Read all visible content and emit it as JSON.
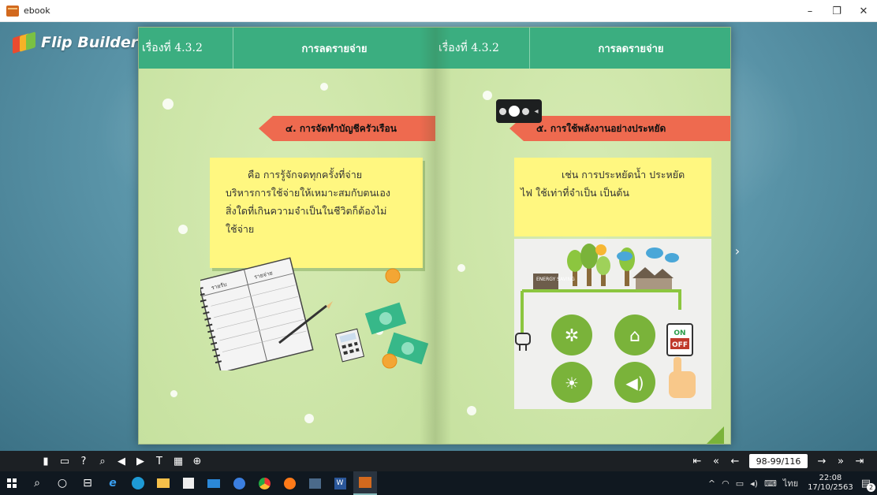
{
  "window": {
    "title": "ebook",
    "controls": [
      "–",
      "❐",
      "✕"
    ]
  },
  "logo": {
    "text": "Flip Builder"
  },
  "left_page": {
    "header_no": "เรื่องที่ 4.3.2",
    "header_topic": "การลดรายจ่าย",
    "ribbon": "๔. การจัดทำบัญชีครัวเรือน",
    "note_lines": [
      "คือ การรู้จักจดทุกครั้งที่จ่าย",
      "บริหารการใช้จ่ายให้เหมาะสมกับตนเอง",
      "สิ่งใดที่เกินความจำเป็นในชีวิตก็ต้องไม่",
      "ใช้จ่าย"
    ],
    "notebook_labels": [
      "รายรับ",
      "รายจ่าย"
    ]
  },
  "right_page": {
    "header_no": "เรื่องที่ 4.3.2",
    "header_topic": "การลดรายจ่าย",
    "ribbon": "๕. การใช้พลังงานอย่างประหยัด",
    "note_lines": [
      "เช่น การประหยัดน้ำ ประหยัด",
      "ไฟ ใช้เท่าที่จำเป็น เป็นต้น"
    ],
    "energy_label": "ENERGY SAVING",
    "switch_on": "ON",
    "switch_off": "OFF"
  },
  "toolbar": {
    "page_indicator": "98-99/116"
  },
  "taskbar": {
    "time": "22:08",
    "date": "17/10/2563",
    "lang": "ไทย",
    "notif_count": "2"
  },
  "colors": {
    "header_green": "#3bae80",
    "page_bg": "#cfe5a9",
    "ribbon": "#ee6a4f",
    "note": "#fff780",
    "toolbar": "#1c2024"
  }
}
